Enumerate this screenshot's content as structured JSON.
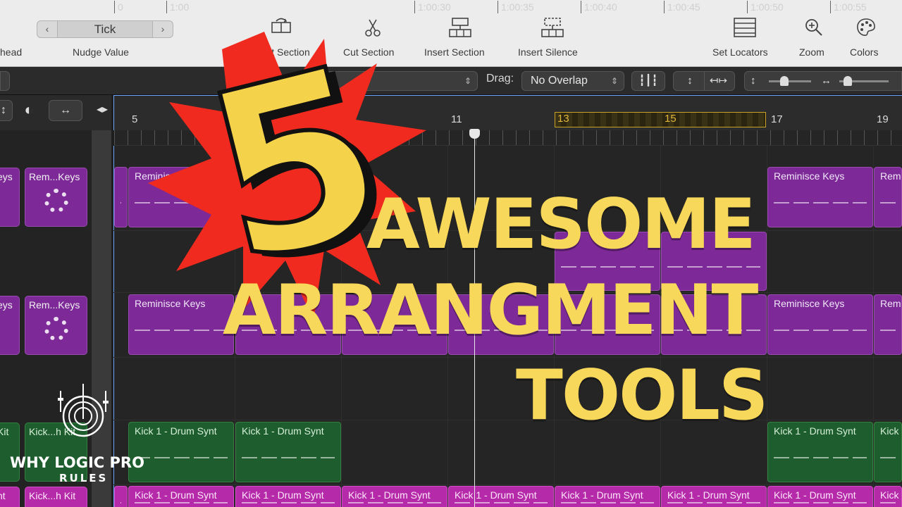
{
  "toolbar": {
    "playhead_fragment": "head",
    "nudge": {
      "value": "Tick",
      "label": "Nudge Value"
    },
    "tools": [
      {
        "label": "Repeat Section",
        "icon": "repeat-section-icon"
      },
      {
        "label": "Cut Section",
        "icon": "scissors-icon"
      },
      {
        "label": "Insert Section",
        "icon": "insert-section-icon"
      },
      {
        "label": "Insert Silence",
        "icon": "insert-silence-icon"
      },
      {
        "label": "Set Locators",
        "icon": "set-locators-icon"
      },
      {
        "label": "Zoom",
        "icon": "zoom-icon"
      },
      {
        "label": "Colors",
        "icon": "palette-icon"
      }
    ]
  },
  "bar2": {
    "snap_value": "S",
    "drag_label": "Drag:",
    "drag_value": "No Overlap"
  },
  "ruler": {
    "times": [
      "0",
      "1:00",
      "1:00:30",
      "1:00:35",
      "1:00:40",
      "1:00:45",
      "1:00:50",
      "1:00:55"
    ],
    "bars": [
      "5",
      "11",
      "17",
      "19"
    ],
    "cycle_bars": [
      "13",
      "15"
    ]
  },
  "track_headers": [
    {
      "label": "eys",
      "label2": "Rem...Keys"
    },
    {
      "label": "eys",
      "label2": "Rem...Keys"
    },
    {
      "label": "Kit",
      "label2": "Kick...h Kit"
    },
    {
      "label": "nt",
      "label2": "Kick...h Kit"
    }
  ],
  "regions": {
    "keys": "Reminisce Keys",
    "keys_short": "Rem",
    "kick": "Kick 1 - Drum Synt",
    "kick_short": "Kick"
  },
  "overlay": {
    "number": "5",
    "line1": "AWESOME",
    "line2": "ARRANGMENT",
    "line3": "TOOLS"
  },
  "watermark": {
    "title": "WHY LOGIC PRO",
    "subtitle": "RULES"
  },
  "colors": {
    "keys": "#7d2a98",
    "kick_green": "#1e5e2e",
    "kick_magenta": "#b52aa8",
    "title": "#f8d85a",
    "burst": "#f02a1e"
  }
}
